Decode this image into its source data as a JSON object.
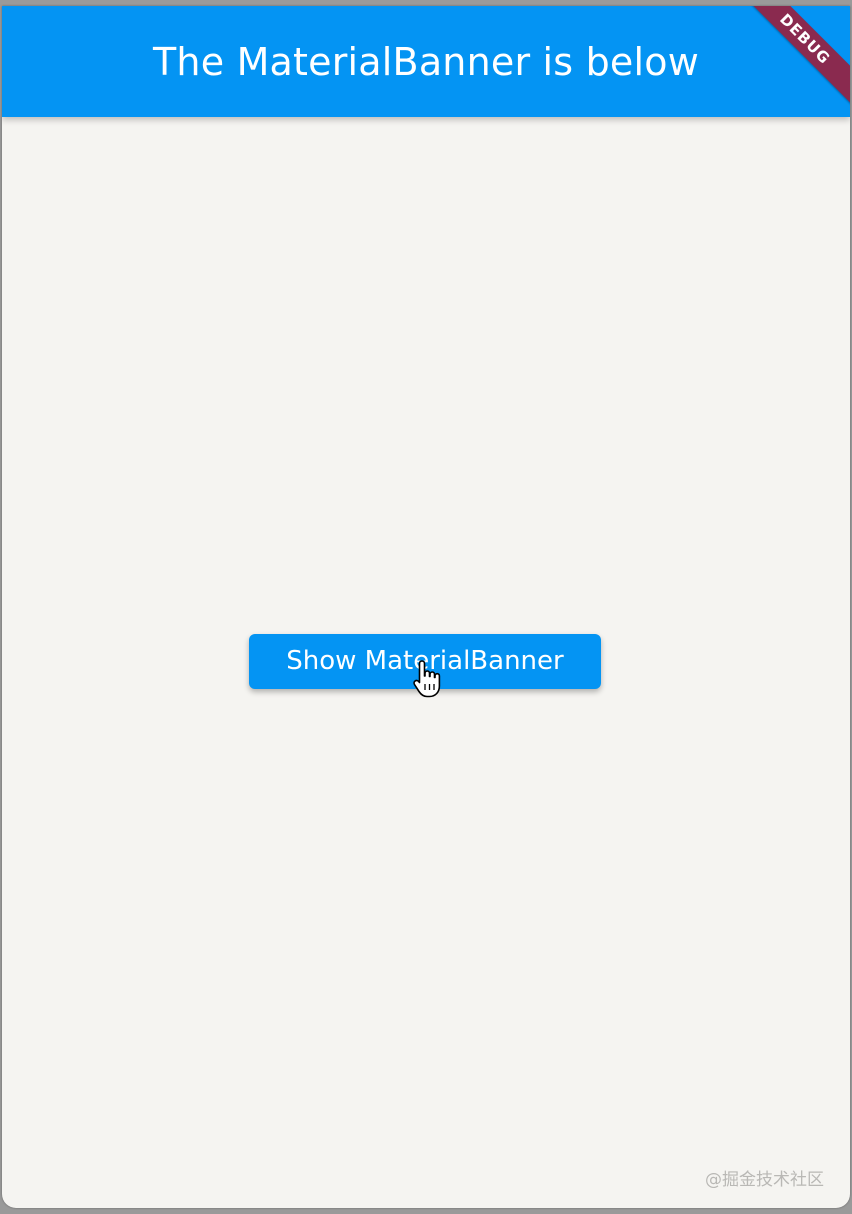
{
  "app_bar": {
    "title": "The MaterialBanner is below",
    "color": "#0494f3"
  },
  "debug_banner": {
    "label": "DEBUG",
    "color": "#8a2a4f"
  },
  "main": {
    "show_button_label": "Show MaterialBanner",
    "cursor_icon": "hand-pointer-icon"
  },
  "watermark": {
    "text": "@掘金技术社区"
  }
}
